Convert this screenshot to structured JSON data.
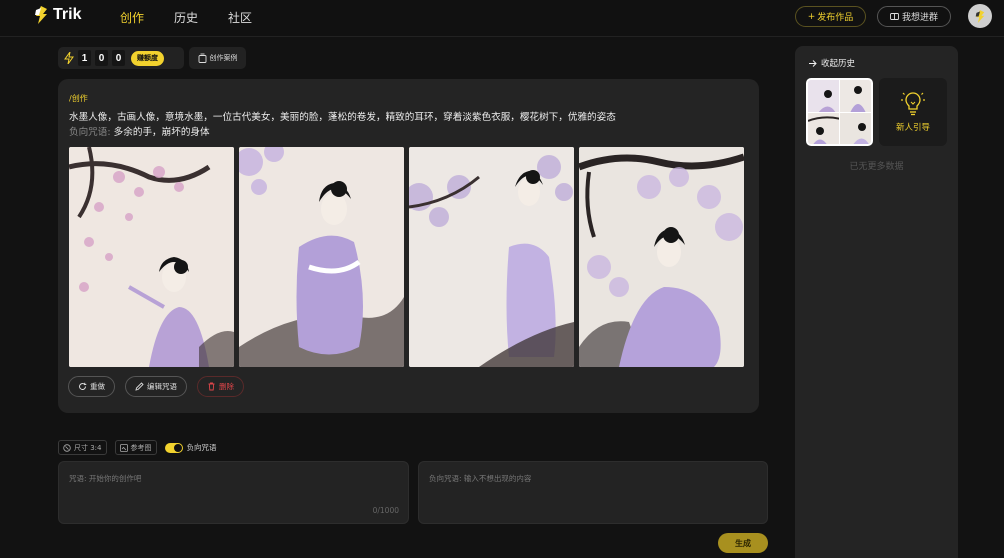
{
  "brand": {
    "name": "Trik"
  },
  "nav": {
    "items": [
      "创作",
      "历史",
      "社区"
    ],
    "active": 0
  },
  "header": {
    "publish_label": "发布作品",
    "join_label": "我想进群"
  },
  "credits": {
    "digits": [
      "1",
      "0",
      "0"
    ],
    "earn_label": "赚额度",
    "cases_label": "创作案例"
  },
  "card": {
    "label": "/创作",
    "prompt": "水墨人像，古画人像，意境水墨，一位古代美女，美丽的脸，蓬松的卷发，精致的耳环，穿着淡紫色衣服，樱花树下，优雅的姿态",
    "negative_label": "负向咒语:",
    "negative_text": "多余的手，崩坏的身体",
    "actions": {
      "redo": "重做",
      "edit": "编辑咒语",
      "delete": "删除"
    }
  },
  "options": {
    "size_label": "尺寸 3:4",
    "ref_label": "参考图",
    "neg_toggle_label": "负向咒语"
  },
  "inputs": {
    "prompt_placeholder": "咒语: 开始你的创作吧",
    "counter": "0/1000",
    "negative_placeholder": "负向咒语: 输入不想出现的内容",
    "generate_label": "生成"
  },
  "history": {
    "title": "收起历史",
    "guide_label": "新人引导",
    "empty_text": "已无更多数据"
  },
  "colors": {
    "accent": "#f2d22e",
    "danger": "#e0464a",
    "background": "#121212",
    "card": "#242424"
  }
}
